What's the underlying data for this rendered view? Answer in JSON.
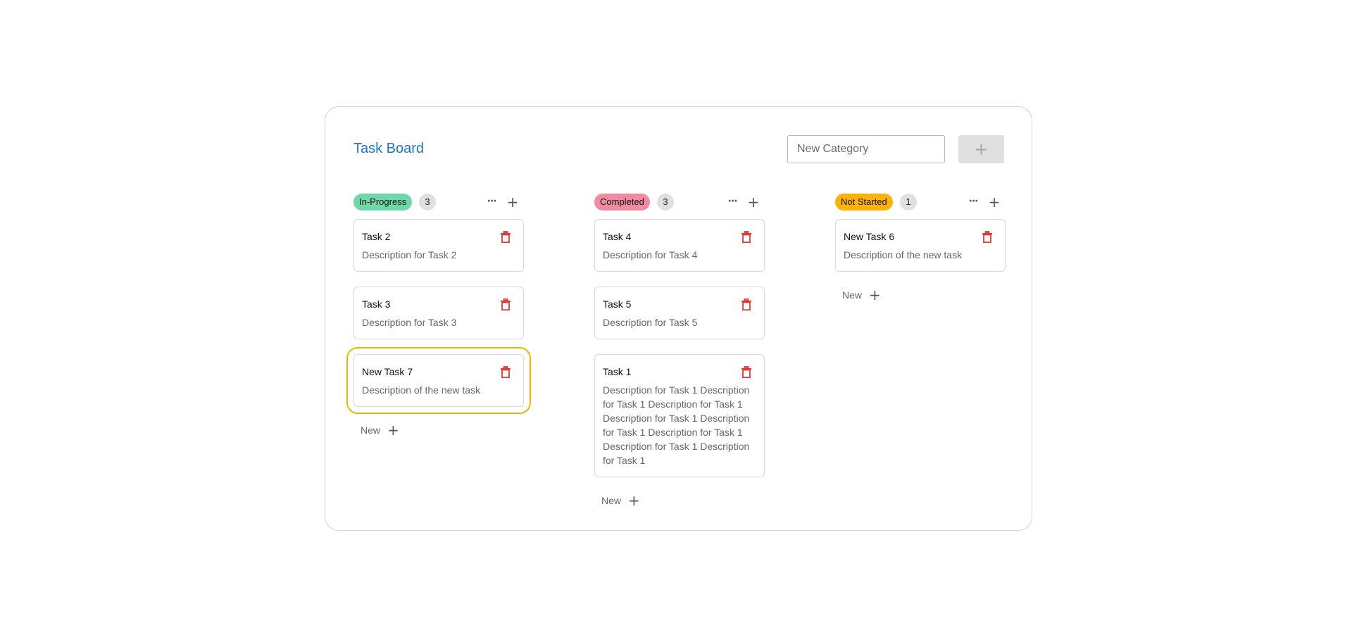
{
  "header": {
    "title": "Task Board",
    "category_placeholder": "New Category",
    "add_category_label": "+"
  },
  "columns": [
    {
      "tag": "In-Progress",
      "tag_color": "#6fd8a8",
      "count": "3",
      "more_label": "···",
      "add_label": "+",
      "new_label": "New",
      "new_plus": "+",
      "tasks": [
        {
          "title": "Task 2",
          "description": "Description for Task 2"
        },
        {
          "title": "Task 3",
          "description": "Description for Task 3"
        },
        {
          "title": "New Task 7",
          "description": "Description of the new task"
        }
      ]
    },
    {
      "tag": "Completed",
      "tag_color": "#f38ba0",
      "count": "3",
      "more_label": "···",
      "add_label": "+",
      "new_label": "New",
      "new_plus": "+",
      "tasks": [
        {
          "title": "Task 4",
          "description": "Description for Task 4"
        },
        {
          "title": "Task 5",
          "description": "Description for Task 5"
        },
        {
          "title": "Task 1",
          "description": "Description for Task 1 Description for Task 1 Description for Task 1 Description for Task 1 Description for Task 1 Description for Task 1 Description for Task 1 Description for Task 1"
        }
      ]
    },
    {
      "tag": "Not Started",
      "tag_color": "#ffb300",
      "count": "1",
      "more_label": "···",
      "add_label": "+",
      "new_label": "New",
      "new_plus": "+",
      "tasks": [
        {
          "title": "New Task 6",
          "description": "Description of the new task"
        }
      ]
    }
  ],
  "colors": {
    "title": "#1976d2",
    "delete_icon": "#e53935",
    "highlight_outline": "#f0b400"
  },
  "icons": {
    "delete": "trash-icon",
    "more": "more-horizontal-icon",
    "add": "plus-icon"
  }
}
